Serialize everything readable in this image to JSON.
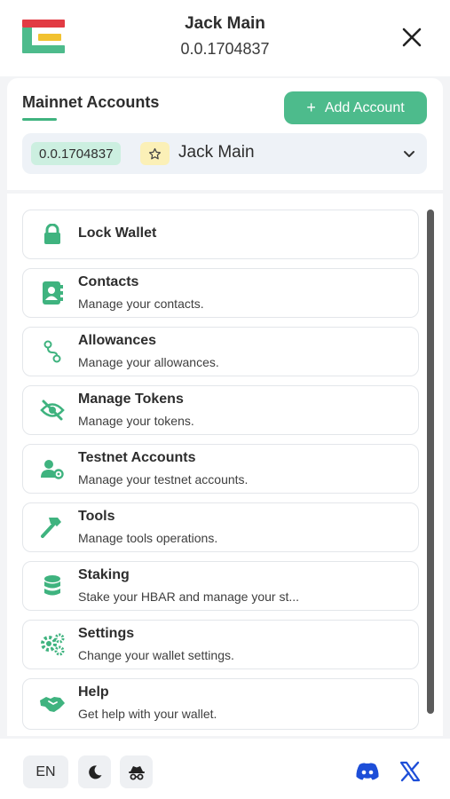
{
  "header": {
    "account_name": "Jack Main",
    "account_id": "0.0.1704837"
  },
  "accounts": {
    "section_title": "Mainnet Accounts",
    "add_button_label": "Add Account",
    "selected_account_id": "0.0.1704837",
    "selected_account_name": "Jack Main"
  },
  "menu": {
    "items": [
      {
        "label": "Lock Wallet",
        "desc": "",
        "icon": "lock-icon"
      },
      {
        "label": "Contacts",
        "desc": "Manage your contacts.",
        "icon": "contacts-icon"
      },
      {
        "label": "Allowances",
        "desc": "Manage your allowances.",
        "icon": "allowances-icon"
      },
      {
        "label": "Manage Tokens",
        "desc": "Manage your tokens.",
        "icon": "eye-slash-icon"
      },
      {
        "label": "Testnet Accounts",
        "desc": "Manage your testnet accounts.",
        "icon": "user-gear-icon"
      },
      {
        "label": "Tools",
        "desc": "Manage tools operations.",
        "icon": "hammer-icon"
      },
      {
        "label": "Staking",
        "desc": "Stake your HBAR and manage your st...",
        "icon": "database-icon"
      },
      {
        "label": "Settings",
        "desc": "Change your wallet settings.",
        "icon": "gears-icon"
      },
      {
        "label": "Help",
        "desc": "Get help with your wallet.",
        "icon": "handshake-icon"
      }
    ]
  },
  "footer": {
    "language": "EN",
    "theme_icon": "moon-icon",
    "privacy_icon": "incognito-icon",
    "discord_icon": "discord-icon",
    "x_icon": "x-icon"
  },
  "colors": {
    "accent": "#3fb37f",
    "add_button": "#4dbb8c",
    "id_badge": "#ccefe0",
    "star_badge": "#fbf0b7",
    "discord": "#5865f2",
    "x_brand": "#1d4ed8"
  }
}
